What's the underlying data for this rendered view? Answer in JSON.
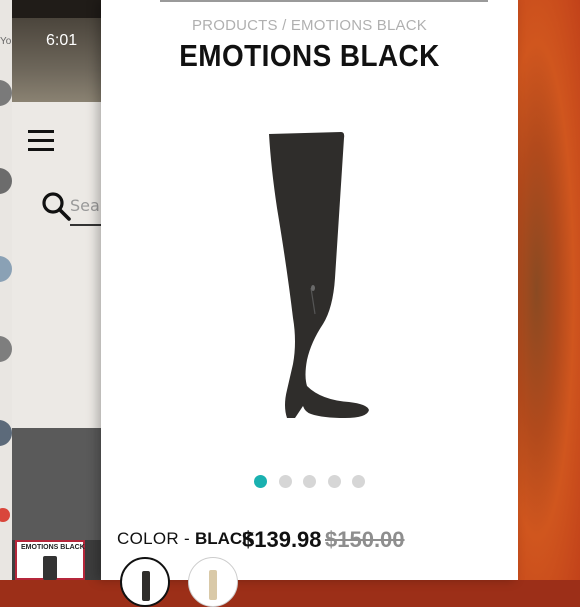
{
  "status": {
    "time": "6:01"
  },
  "back_app": {
    "search_placeholder": "Search",
    "strip_text": "Yo",
    "thumb_title": "EMOTIONS BLACK"
  },
  "product": {
    "breadcrumb": "PRODUCTS / EMOTIONS BLACK",
    "title": "EMOTIONS BLACK",
    "color_label": "COLOR - ",
    "color_value": "BLACK",
    "price": "$139.98",
    "original_price": "$150.00",
    "image_count": 5,
    "active_image": 1
  },
  "colors": {
    "accent": "#1ab1b0",
    "boot": "#2f2d2b"
  }
}
